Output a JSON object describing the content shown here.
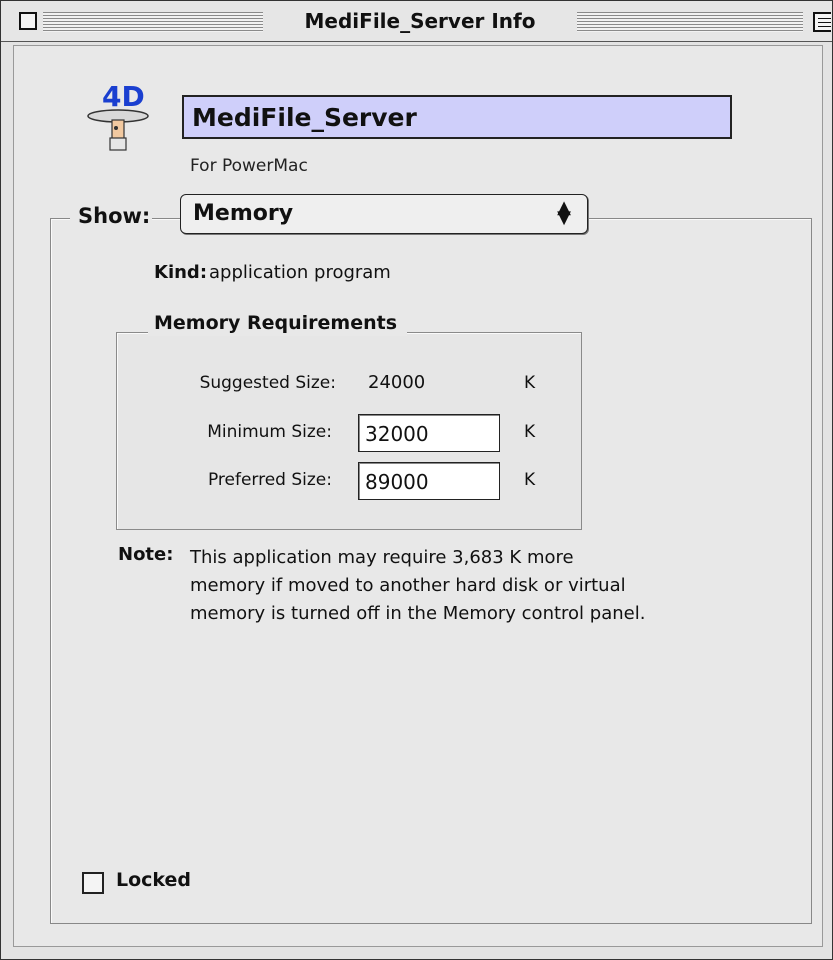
{
  "window": {
    "title": "MediFile_Server Info"
  },
  "header": {
    "name": "MediFile_Server",
    "platform": "For PowerMac",
    "icon": "4d-application-icon"
  },
  "show": {
    "label": "Show:",
    "selected": "Memory"
  },
  "kind": {
    "label": "Kind:",
    "value": "application program"
  },
  "memory_requirements": {
    "title": "Memory Requirements",
    "suggested": {
      "label": "Suggested Size:",
      "value": "24000",
      "unit": "K"
    },
    "minimum": {
      "label": "Minimum Size:",
      "value": "32000",
      "unit": "K"
    },
    "preferred": {
      "label": "Preferred Size:",
      "value": "89000",
      "unit": "K"
    }
  },
  "note": {
    "label": "Note:",
    "lines": [
      "This application may require 3,683 K more",
      "memory if moved to another hard disk or virtual",
      "memory is turned off in the Memory control panel."
    ]
  },
  "locked": {
    "label": "Locked",
    "checked": false
  },
  "colors": {
    "name_highlight": "#cfcffa",
    "window_bg": "#e8e8e8"
  }
}
